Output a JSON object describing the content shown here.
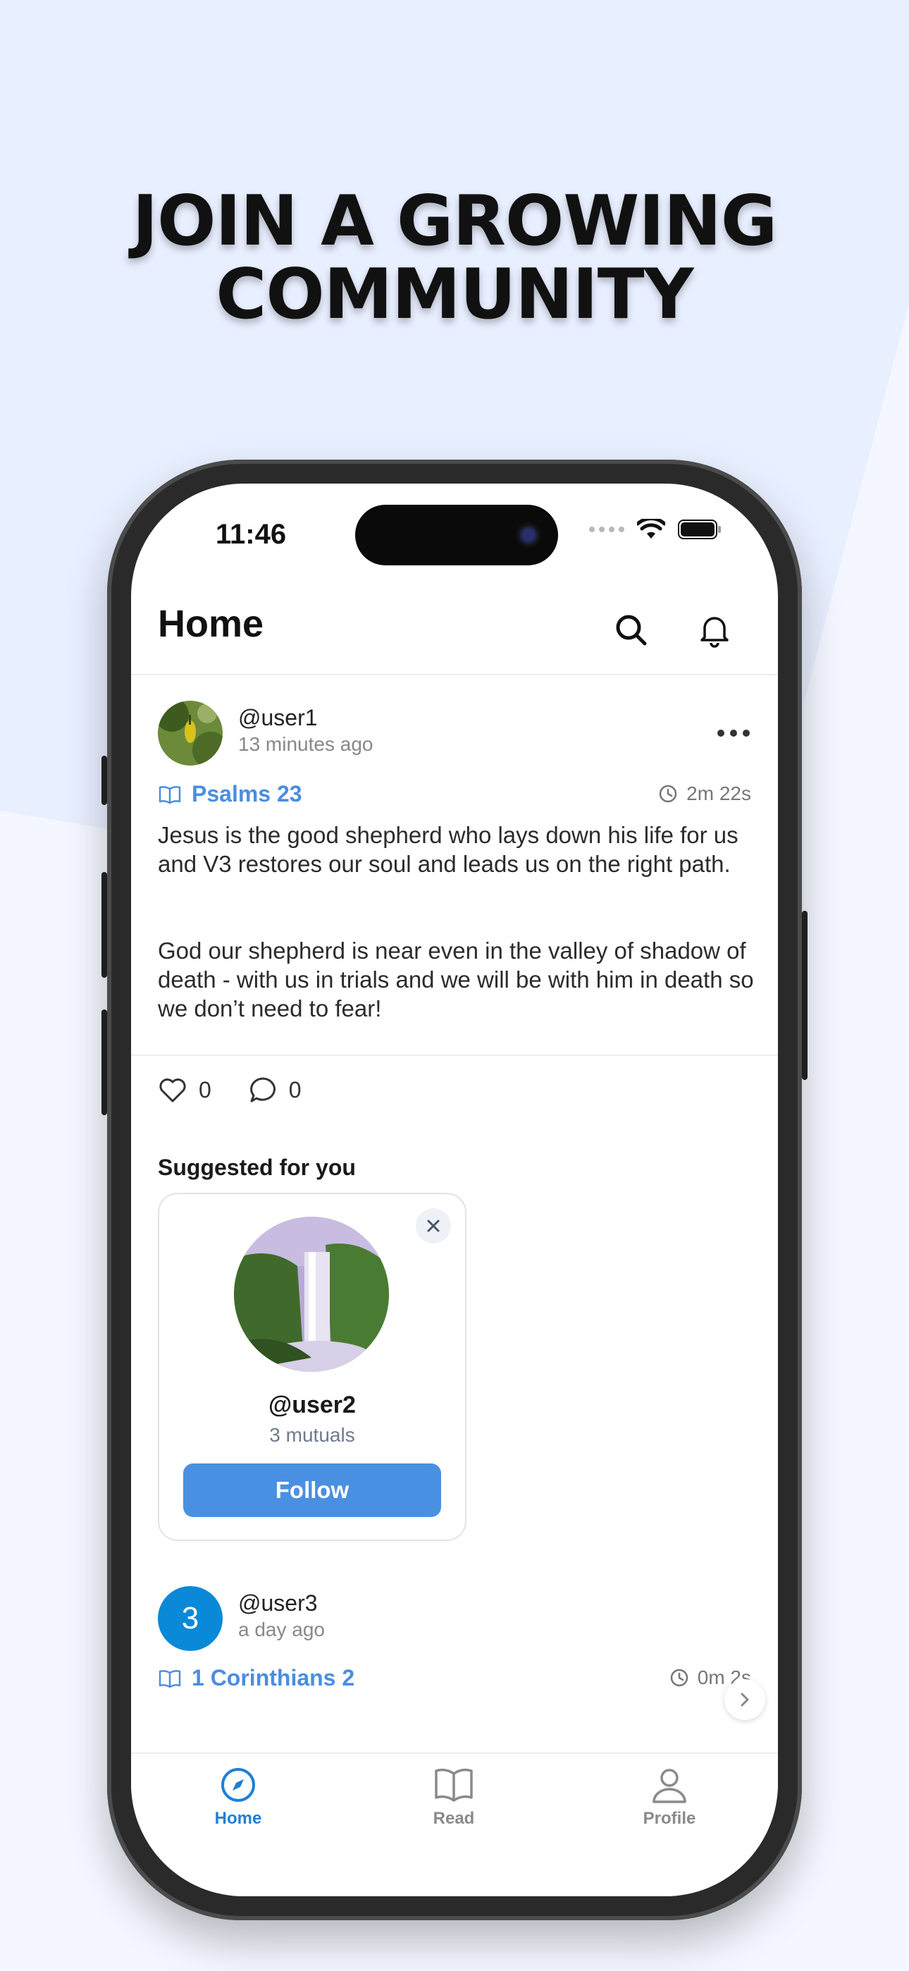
{
  "headline": {
    "line1": "JOIN A GROWING",
    "line2": "COMMUNITY"
  },
  "status_bar": {
    "time": "11:46"
  },
  "header": {
    "title": "Home"
  },
  "post1": {
    "username": "@user1",
    "time_ago": "13 minutes ago",
    "reference": "Psalms 23",
    "duration": "2m 22s",
    "paragraph1": "Jesus is the good shepherd who lays down his life for us and V3 restores our soul and leads us on the right path.",
    "paragraph2": "God our shepherd is near even in the valley of shadow of death - with us in trials and we will be with him in death so we don’t need to fear!",
    "likes": "0",
    "comments": "0"
  },
  "suggested": {
    "title": "Suggested for you",
    "username": "@user2",
    "mutuals": "3 mutuals",
    "follow_label": "Follow"
  },
  "post2": {
    "avatar_initial": "3",
    "username": "@user3",
    "time_ago": "a day ago",
    "reference": "1 Corinthians 2",
    "duration": "0m 2s"
  },
  "tabs": [
    {
      "label": "Home",
      "icon": "compass-icon",
      "active": true
    },
    {
      "label": "Read",
      "icon": "book-icon",
      "active": false
    },
    {
      "label": "Profile",
      "icon": "person-icon",
      "active": false
    }
  ],
  "colors": {
    "accent": "#4a90e2",
    "background": "#e8efff",
    "active_tab": "#1f7fd4"
  }
}
